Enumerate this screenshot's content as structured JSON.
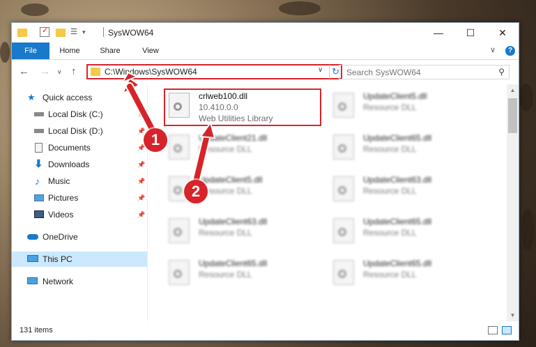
{
  "window": {
    "title": "SysWOW64",
    "minimize_glyph": "—",
    "maximize_glyph": "☐",
    "close_glyph": "✕"
  },
  "ribbon": {
    "tabs": [
      "File",
      "Home",
      "Share",
      "View"
    ],
    "collapse_glyph": "∨",
    "help_glyph": "?"
  },
  "nav": {
    "back_glyph": "←",
    "forward_glyph": "→",
    "recent_glyph": "∨",
    "up_glyph": "↑",
    "address_path": "C:\\Windows\\SysWOW64",
    "search_placeholder": "Search SysWOW64"
  },
  "sidebar": {
    "items": [
      {
        "label": "Quick access",
        "icon": "star-icon",
        "pinned": false
      },
      {
        "label": "Local Disk (C:)",
        "icon": "drive-icon",
        "pinned": true
      },
      {
        "label": "Local Disk (D:)",
        "icon": "drive-icon",
        "pinned": true
      },
      {
        "label": "Documents",
        "icon": "documents-icon",
        "pinned": true
      },
      {
        "label": "Downloads",
        "icon": "downloads-icon",
        "pinned": true
      },
      {
        "label": "Music",
        "icon": "music-icon",
        "pinned": true
      },
      {
        "label": "Pictures",
        "icon": "pictures-icon",
        "pinned": true
      },
      {
        "label": "Videos",
        "icon": "videos-icon",
        "pinned": true
      },
      {
        "label": "OneDrive",
        "icon": "cloud-icon",
        "pinned": false
      },
      {
        "label": "This PC",
        "icon": "computer-icon",
        "pinned": false,
        "selected": true
      },
      {
        "label": "Network",
        "icon": "network-icon",
        "pinned": false
      }
    ]
  },
  "files": [
    {
      "name": "crlweb100.dll",
      "version": "10.410.0.0",
      "description": "Web Utilities Library"
    },
    {
      "name": "UpdateClient5.dll",
      "version": "",
      "description": "Resource DLL"
    },
    {
      "name": "UpdateClient21.dll",
      "version": "",
      "description": "Resource DLL"
    },
    {
      "name": "UpdateClient65.dll",
      "version": "",
      "description": "Resource DLL"
    },
    {
      "name": "UpdateClient5.dll",
      "version": "",
      "description": "Resource DLL"
    },
    {
      "name": "UpdateClient63.dll",
      "version": "",
      "description": "Resource DLL"
    },
    {
      "name": "UpdateClient63.dll",
      "version": "",
      "description": "Resource DLL"
    },
    {
      "name": "UpdateClient65.dll",
      "version": "",
      "description": "Resource DLL"
    },
    {
      "name": "UpdateClient65.dll",
      "version": "",
      "description": "Resource DLL"
    },
    {
      "name": "UpdateClient65.dll",
      "version": "",
      "description": "Resource DLL"
    }
  ],
  "status": {
    "item_count": "131 items"
  },
  "annotations": {
    "badge_1": "1",
    "badge_2": "2",
    "highlight_color": "#d8232a"
  },
  "colors": {
    "accent": "#1979ca",
    "selected_bg": "#cce8ff"
  }
}
